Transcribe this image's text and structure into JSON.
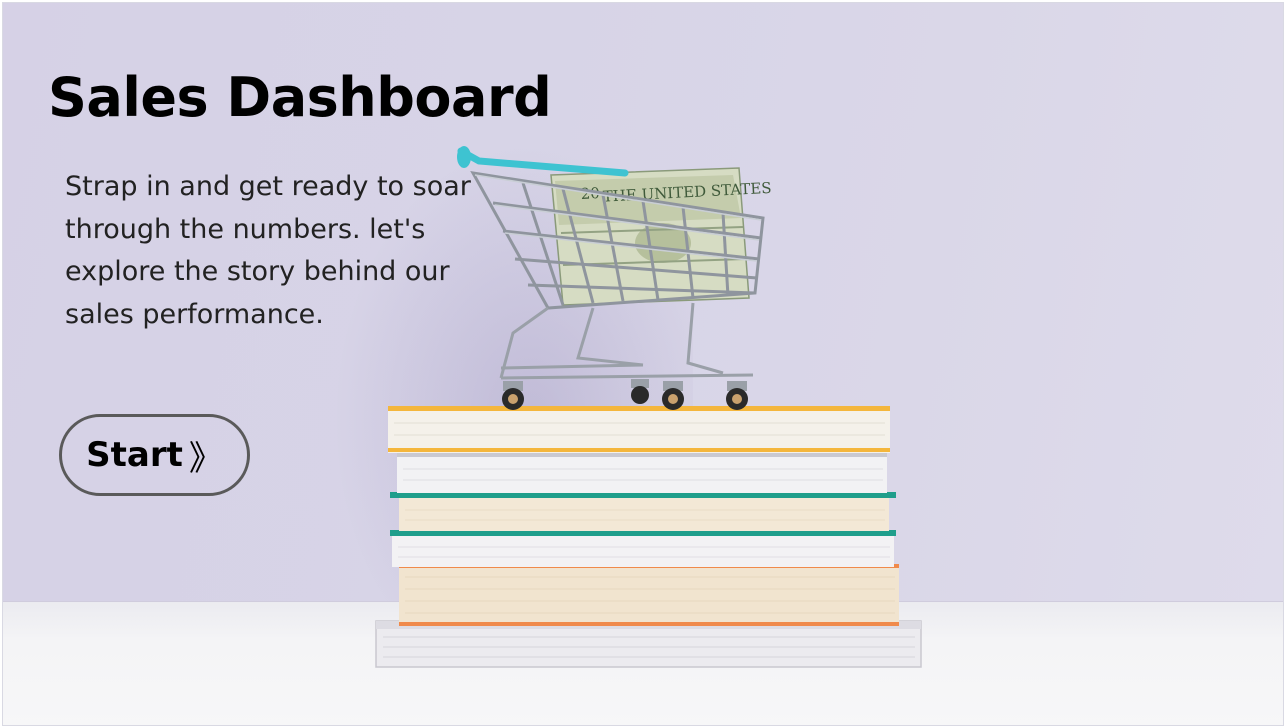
{
  "hero": {
    "title": "Sales Dashboard",
    "subtitle": "Strap in and get ready to soar through the numbers. let's explore the story behind our sales performance.",
    "start_button": {
      "label": "Start",
      "icon": "double-chevron-right-icon",
      "icon_glyph": "》"
    }
  },
  "image": {
    "description_icon": "shopping-cart-on-books-illustration",
    "money_text": "THE UNITED STATES"
  },
  "colors": {
    "background_wall": "#d7d4e7",
    "table_surface": "#f4f4f6",
    "title_text": "#000000",
    "body_text": "#222222",
    "button_border": "#5a5a5a",
    "cart_handle": "#3ec3d1"
  }
}
